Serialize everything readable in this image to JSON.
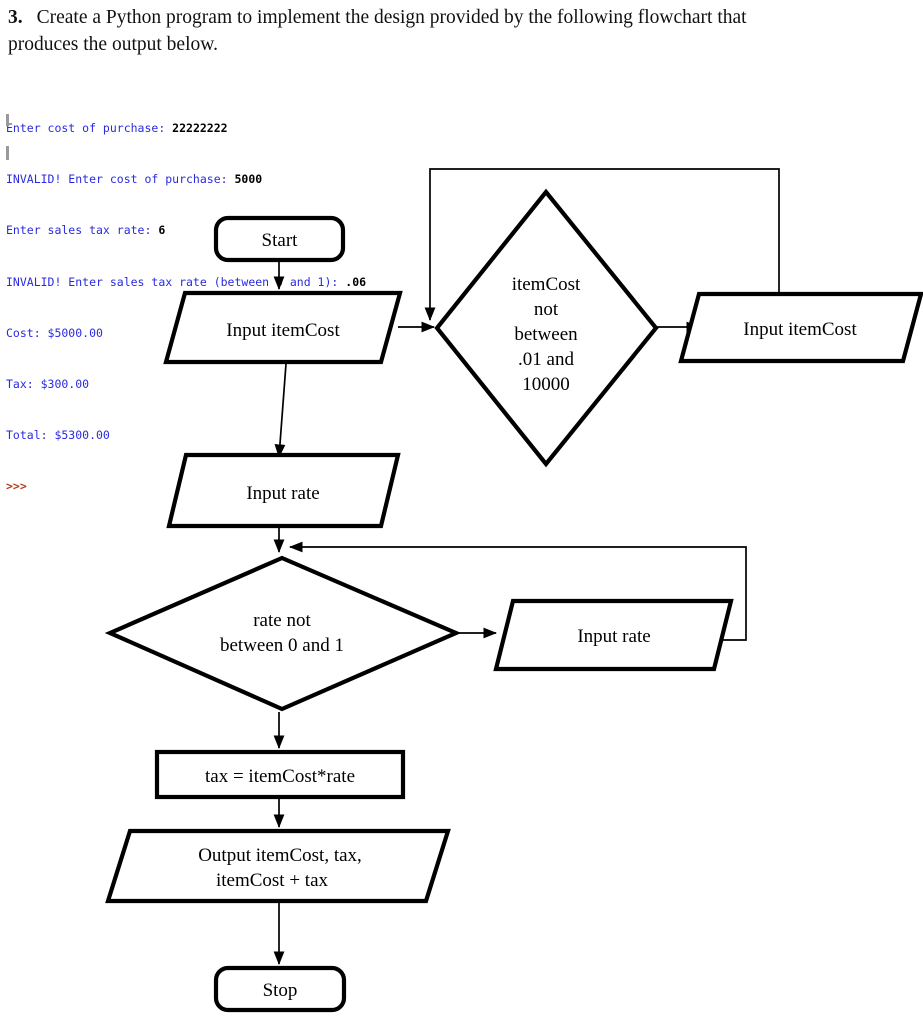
{
  "question": {
    "number": "3.",
    "text": "Create a Python program to implement the design provided by the following flowchart that produces the output below."
  },
  "console": {
    "lines": [
      {
        "prompt": "Enter cost of purchase: ",
        "input": "22222222"
      },
      {
        "prompt": "INVALID! Enter cost of purchase: ",
        "input": "5000"
      },
      {
        "prompt": "Enter sales tax rate: ",
        "input": "6"
      },
      {
        "prompt": "INVALID! Enter sales tax rate (between 0 and 1): ",
        "input": ".06"
      },
      {
        "prompt": "Cost: $5000.00",
        "input": ""
      },
      {
        "prompt": "Tax: $300.00",
        "input": ""
      },
      {
        "prompt": "Total: $5300.00",
        "input": ""
      }
    ],
    "shell_prompt": ">>>",
    "prompt_color": "#2a2ae0",
    "input_color": "#000000",
    "chevron_color": "#b03a18"
  },
  "flowchart": {
    "nodes": {
      "start": {
        "label": "Start",
        "shape": "terminal"
      },
      "input_item_cost_1": {
        "label": "Input itemCost",
        "shape": "parallelogram"
      },
      "decision_item_cost": {
        "shape": "diamond",
        "lines": [
          "itemCost",
          "not",
          "between",
          ".01 and",
          "10000"
        ]
      },
      "input_item_cost_2": {
        "label": "Input itemCost",
        "shape": "parallelogram"
      },
      "input_rate_1": {
        "label": "Input rate",
        "shape": "parallelogram"
      },
      "decision_rate": {
        "shape": "diamond",
        "lines": [
          "rate not",
          "between 0 and 1"
        ]
      },
      "input_rate_2": {
        "label": "Input rate",
        "shape": "parallelogram"
      },
      "tax_process": {
        "label": "tax = itemCost*rate",
        "shape": "rectangle"
      },
      "output_results": {
        "shape": "parallelogram",
        "lines": [
          "Output itemCost, tax,",
          "itemCost + tax"
        ]
      },
      "stop": {
        "label": "Stop",
        "shape": "terminal"
      }
    },
    "stroke_color": "#000000",
    "fill_color": "#ffffff"
  }
}
